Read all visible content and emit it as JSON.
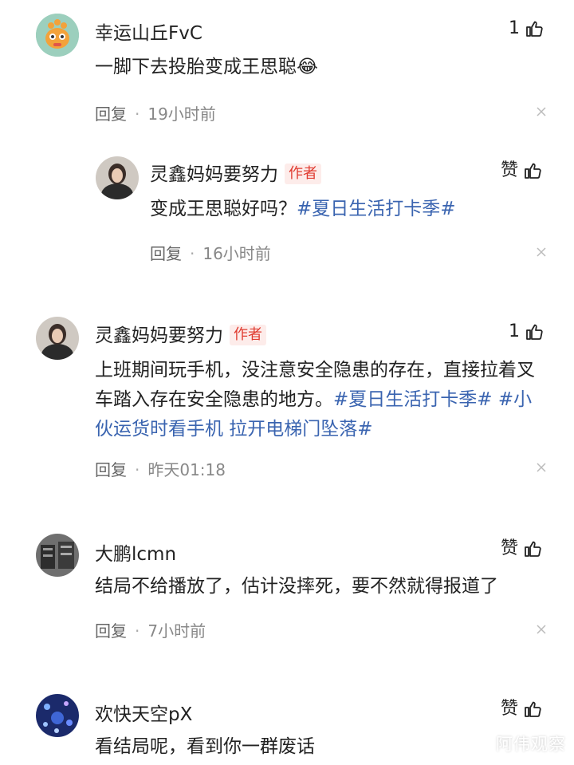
{
  "comments": [
    {
      "user": "幸运山丘FvC",
      "text": "一脚下去投胎变成王思聪",
      "emoji": "😂",
      "reply_label": "回复",
      "time": "19小时前",
      "like_label": "1"
    },
    {
      "user": "灵鑫妈妈要努力",
      "author_tag": "作者",
      "text": "变成王思聪好吗？",
      "hashtag": "#夏日生活打卡季#",
      "reply_label": "回复",
      "time": "16小时前",
      "like_label": "赞"
    },
    {
      "user": "灵鑫妈妈要努力",
      "author_tag": "作者",
      "text_line1_a": "上班期间玩手机，没注意安全隐患的存在，直接拉着叉",
      "text_line2_a": "车踏入存在安全隐患的地方。",
      "text_line2_tag": "#夏日生活打卡季# #小",
      "text_line3_tag": "伙运货时看手机 拉开电梯门坠落#",
      "reply_label": "回复",
      "time": "昨天01:18",
      "like_label": "1"
    },
    {
      "user": "大鹏lcmn",
      "text": "结局不给播放了，估计没摔死，要不然就得报道了",
      "reply_label": "回复",
      "time": "7小时前",
      "like_label": "赞"
    },
    {
      "user": "欢快天空pX",
      "text": "看结局呢，看到你一群废话",
      "like_label": "赞"
    }
  ],
  "watermark": "阿伟观察",
  "colors": {
    "hashtag": "#3a64b0",
    "author_tag": "#e03b30",
    "author_tag_bg": "#fdecea"
  }
}
